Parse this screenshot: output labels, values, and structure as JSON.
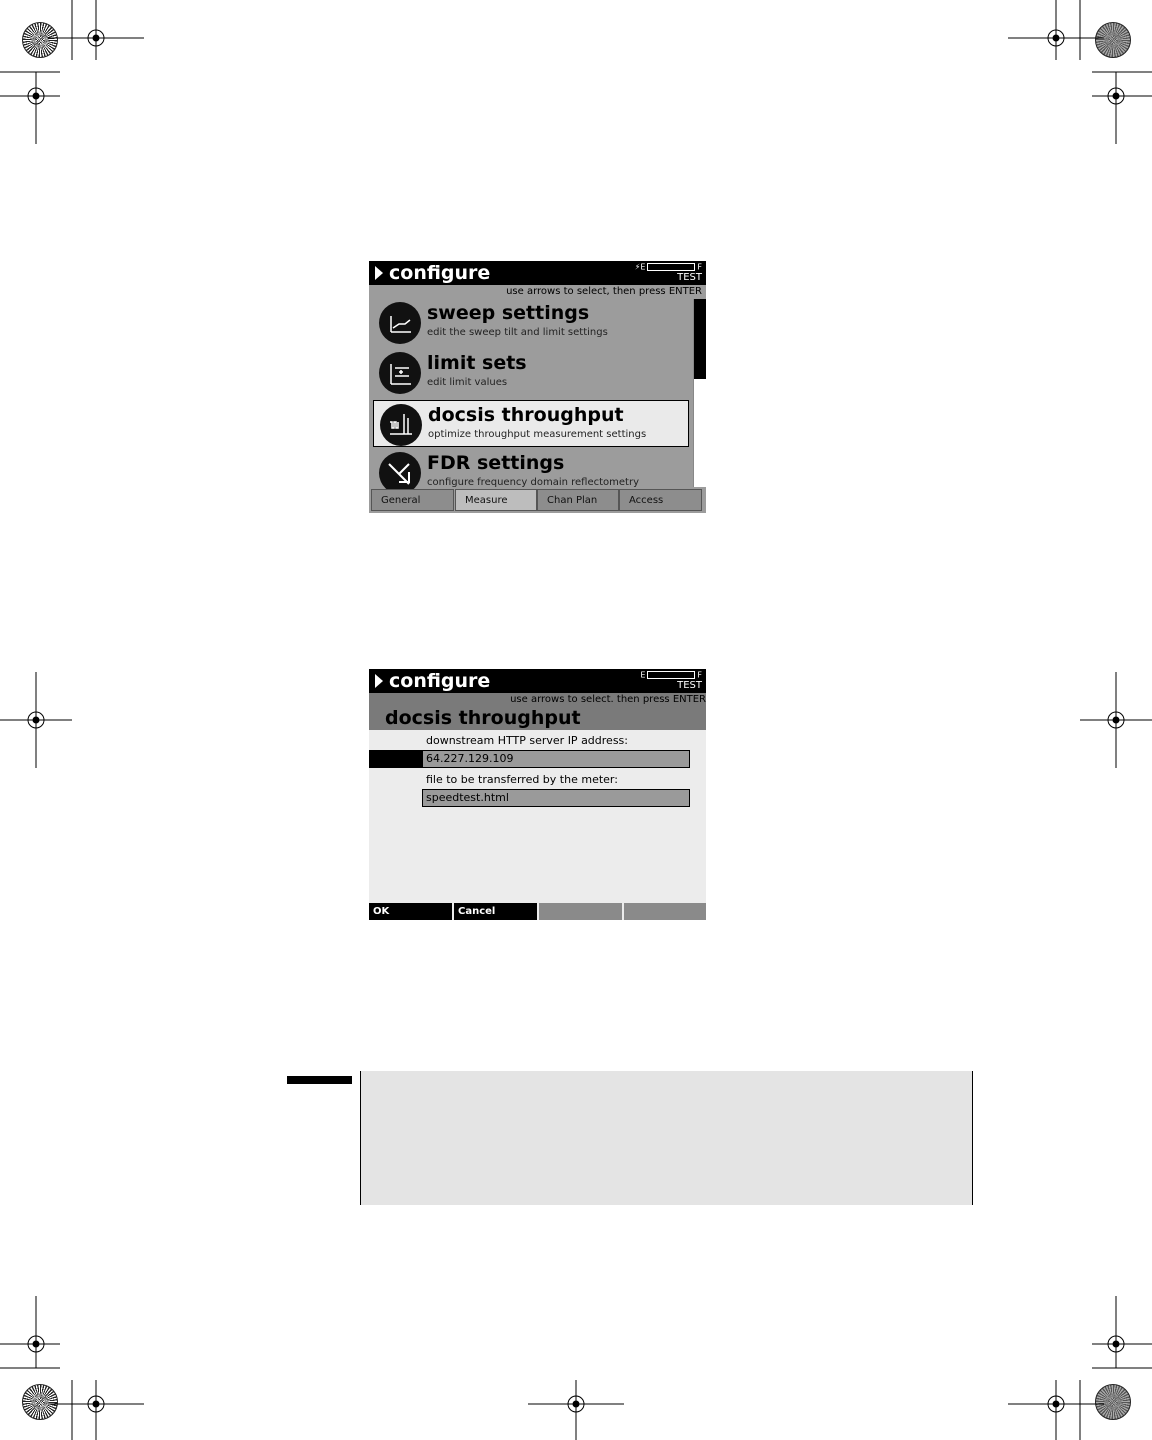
{
  "screen1": {
    "title": "configure",
    "status": "TEST",
    "hint": "use arrows to select, then press ENTER",
    "battery": {
      "left": "E",
      "right": "F"
    },
    "menu_items": [
      {
        "name": "sweep settings",
        "desc": "edit the sweep tilt and limit settings",
        "icon": "sweep-icon",
        "selected": false
      },
      {
        "name": "limit sets",
        "desc": "edit limit values",
        "icon": "limit-icon",
        "selected": false
      },
      {
        "name": "docsis throughput",
        "desc": "optimize throughput measurement settings",
        "icon": "throughput-icon",
        "selected": true
      },
      {
        "name": "FDR settings",
        "desc": "configure frequency domain reflectometry",
        "icon": "fdr-icon",
        "selected": false
      }
    ],
    "tabs": [
      "General",
      "Measure",
      "Chan Plan",
      "Access"
    ],
    "active_tab": "Measure"
  },
  "screen2": {
    "title": "configure",
    "status": "TEST",
    "hint": "use arrows to select. then press ENTER",
    "battery": {
      "left": "E",
      "right": "F"
    },
    "page_title": "docsis throughput",
    "fields": [
      {
        "label": "downstream HTTP server IP address:",
        "value": "64.227.129.109"
      },
      {
        "label": "file to be transferred by the meter:",
        "value": "speedtest.html"
      }
    ],
    "softkeys": [
      "OK",
      "Cancel",
      "",
      ""
    ]
  },
  "colors": {
    "screen_bg": "#9c9c9c",
    "titlebar": "#000000",
    "selected_item": "#eaeaea",
    "note_bg": "#e4e4e4"
  }
}
